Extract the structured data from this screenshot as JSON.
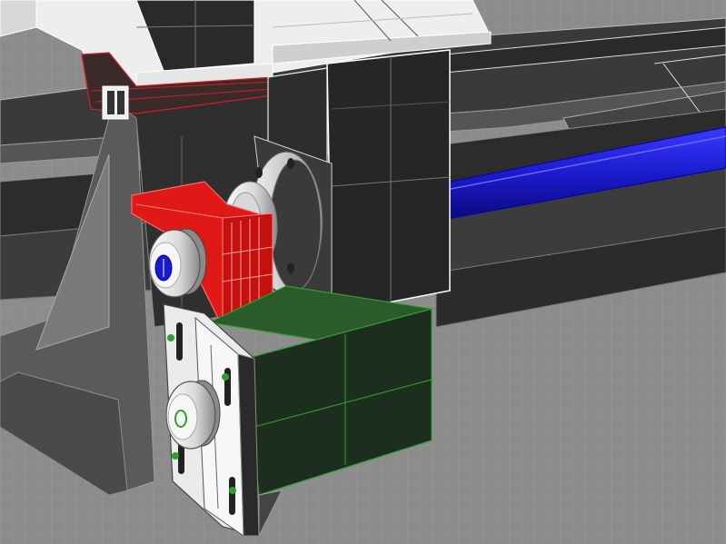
{
  "viewport": {
    "display_mode": "shaded-wireframe",
    "background_color": "#8a8a8a",
    "grid_color": "#9a9a9a"
  },
  "colors": {
    "frame_dark": "#2e2e2e",
    "frame_gray": "#5a5a5a",
    "frame_light": "#f2f2f2",
    "edge_white": "#ffffff",
    "bracket_red": "#e01818",
    "motor_green": "#1c3a1c",
    "motor_green_edge": "#2fa02f",
    "rod_blue": "#1a1acc",
    "selection_red_outline": "#c00000"
  },
  "objects": [
    {
      "name": "top-carriage",
      "color": "frame_light"
    },
    {
      "name": "vertical-column-block",
      "color": "frame_dark"
    },
    {
      "name": "linear-rail",
      "color": "frame_dark"
    },
    {
      "name": "lead-screw-rod",
      "color": "rod_blue"
    },
    {
      "name": "motor-mount-bracket",
      "color": "bracket_red"
    },
    {
      "name": "stepper-motor",
      "color": "motor_green"
    },
    {
      "name": "bearing-flange",
      "color": "frame_light"
    },
    {
      "name": "idler-pulley-upper",
      "color": "frame_light"
    },
    {
      "name": "idler-pulley-lower",
      "color": "frame_light"
    },
    {
      "name": "end-plate",
      "color": "frame_light"
    },
    {
      "name": "triangle-brace",
      "color": "frame_gray"
    }
  ]
}
